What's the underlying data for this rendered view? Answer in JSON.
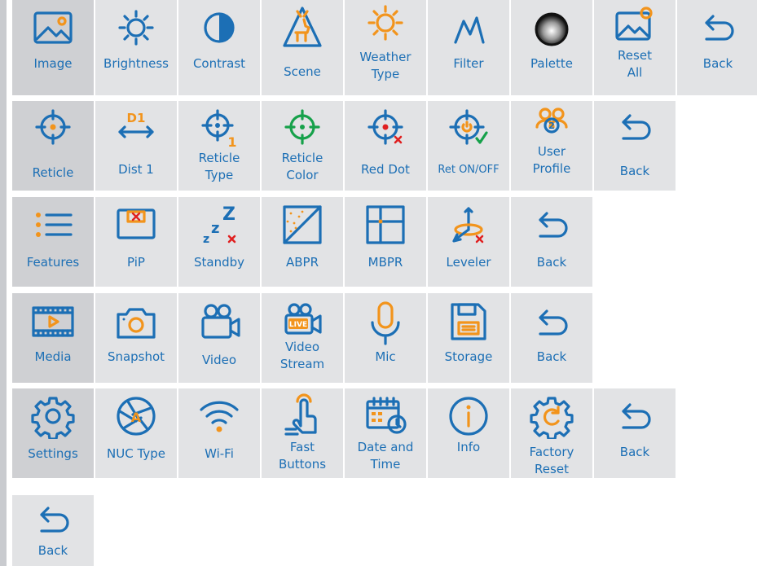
{
  "rows": {
    "image": {
      "image": "Image",
      "brightness": "Brightness",
      "contrast": "Contrast",
      "scene": "Scene",
      "weather_type": "Weather\nType",
      "filter": "Filter",
      "palette": "Palette",
      "reset_all": "Reset\nAll",
      "back": "Back"
    },
    "reticle": {
      "reticle": "Reticle",
      "dist1": "Dist 1",
      "reticle_type": "Reticle\nType",
      "reticle_color": "Reticle\nColor",
      "red_dot": "Red Dot",
      "ret_onoff": "Ret ON/OFF",
      "user_profile": "User\nProfile",
      "back": "Back"
    },
    "features": {
      "features": "Features",
      "pip": "PiP",
      "standby": "Standby",
      "abpr": "ABPR",
      "mbpr": "MBPR",
      "leveler": "Leveler",
      "back": "Back"
    },
    "media": {
      "media": "Media",
      "snapshot": "Snapshot",
      "video": "Video",
      "video_stream": "Video\nStream",
      "mic": "Mic",
      "storage": "Storage",
      "back": "Back"
    },
    "settings": {
      "settings": "Settings",
      "nuc_type": "NUC Type",
      "wifi": "Wi-Fi",
      "fast_buttons": "Fast\nButtons",
      "date_time": "Date and\nTime",
      "info": "Info",
      "factory_reset": "Factory\nReset",
      "back": "Back"
    },
    "main": {
      "back": "Back"
    }
  },
  "icon_text": {
    "dist1": "D1",
    "reticle_type_num": "1",
    "profile_num": "2",
    "live": "LIVE",
    "nuc": "A"
  },
  "colors": {
    "icon_blue": "#1c6fb5",
    "accent_orange": "#f2941c",
    "accent_green": "#16a14a",
    "accent_red": "#e02020",
    "tile_bg": "#e2e3e5",
    "active_tile_bg": "#cfd0d3"
  }
}
